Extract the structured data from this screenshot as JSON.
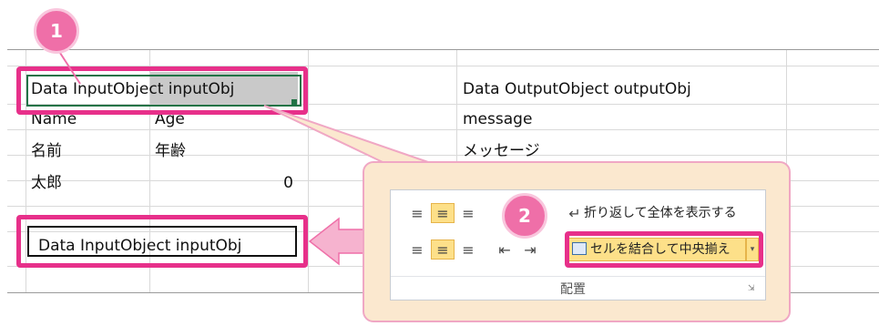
{
  "badges": {
    "first": "1",
    "second": "2"
  },
  "sheet": {
    "header_cell": "Data InputObject inputObj",
    "output_header": "Data OutputObject outputObj",
    "rows": [
      {
        "a": "Name",
        "b": "Age",
        "e": "message"
      },
      {
        "a": "名前",
        "b": "年齢",
        "e": "メッセージ"
      },
      {
        "a": "太郎",
        "b": "0"
      }
    ],
    "result_cell": "Data InputObject inputObj"
  },
  "ribbon": {
    "wrap_text_label": "折り返して全体を表示する",
    "merge_center_label": "セルを結合して中央揃え",
    "group_label": "配置"
  },
  "colors": {
    "highlight": "#e7308a",
    "badge": "#ef6fa8",
    "callout_bg": "#fbe8cf",
    "active_button": "#fde089"
  }
}
